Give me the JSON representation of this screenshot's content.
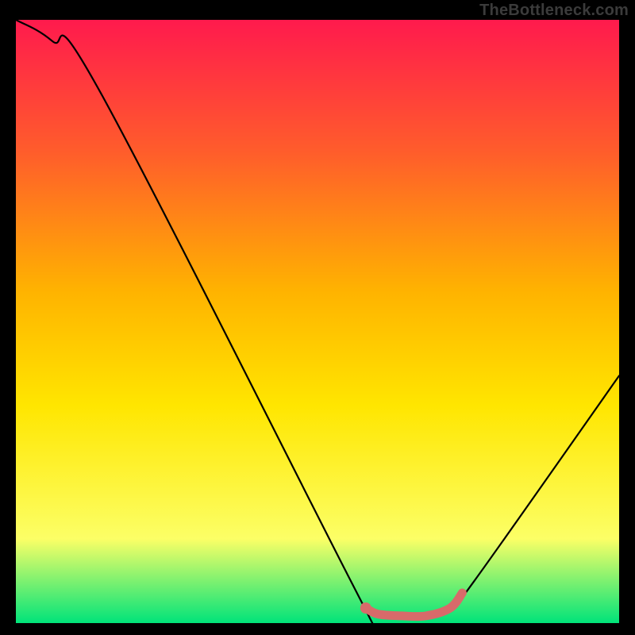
{
  "attribution": "TheBottleneck.com",
  "colors": {
    "background": "#000000",
    "gradient_top": "#ff1a4d",
    "gradient_mid1": "#ff5d2b",
    "gradient_mid2": "#ffb300",
    "gradient_mid3": "#ffe600",
    "gradient_mid4": "#fcff66",
    "gradient_bottom": "#00e37a",
    "curve": "#000000",
    "highlight": "#d86a6a"
  },
  "chart_data": {
    "type": "line",
    "title": "",
    "xlabel": "",
    "ylabel": "",
    "xlim": [
      0,
      100
    ],
    "ylim": [
      0,
      100
    ],
    "series": [
      {
        "name": "bottleneck-curve",
        "points": [
          {
            "x": 0,
            "y": 100
          },
          {
            "x": 6,
            "y": 96.5
          },
          {
            "x": 14,
            "y": 88
          },
          {
            "x": 55,
            "y": 8
          },
          {
            "x": 58,
            "y": 2.5
          },
          {
            "x": 60,
            "y": 1.5
          },
          {
            "x": 64,
            "y": 1.2
          },
          {
            "x": 68,
            "y": 1.2
          },
          {
            "x": 72,
            "y": 2.5
          },
          {
            "x": 76,
            "y": 7
          },
          {
            "x": 100,
            "y": 41
          }
        ]
      },
      {
        "name": "optimal-zone",
        "points": [
          {
            "x": 58,
            "y": 2.5
          },
          {
            "x": 60,
            "y": 1.5
          },
          {
            "x": 64,
            "y": 1.2
          },
          {
            "x": 68,
            "y": 1.2
          },
          {
            "x": 72,
            "y": 2.5
          },
          {
            "x": 74,
            "y": 5
          }
        ]
      }
    ],
    "marker": {
      "x": 58,
      "y": 2.5
    }
  }
}
